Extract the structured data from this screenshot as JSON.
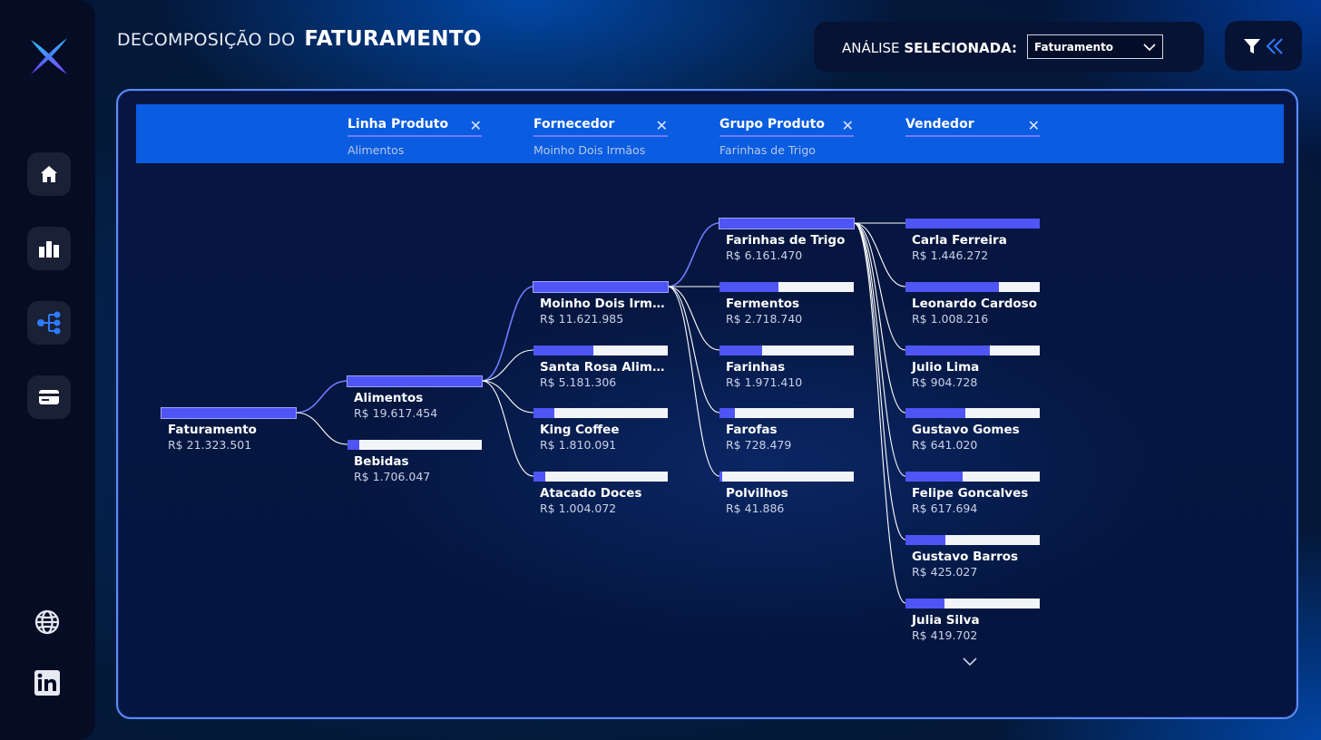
{
  "header": {
    "title_light": "DECOMPOSIÇÃO DO",
    "title_bold": "FATURAMENTO",
    "analysis_label": "ANÁLISE",
    "analysis_label_bold": "SELECIONADA:",
    "analysis_value": "Faturamento"
  },
  "sidebar": {
    "items": [
      {
        "name": "home",
        "icon": "home-icon"
      },
      {
        "name": "charts",
        "icon": "bar-chart-icon"
      },
      {
        "name": "decomposition",
        "icon": "tree-icon"
      },
      {
        "name": "card",
        "icon": "card-icon"
      }
    ],
    "bottom": [
      {
        "name": "website",
        "icon": "globe-icon"
      },
      {
        "name": "linkedin",
        "icon": "linkedin-icon"
      }
    ]
  },
  "colors": {
    "accent": "#4f54f5",
    "band": "#0a5ce0",
    "panel_border": "#5a8df0"
  },
  "tree": {
    "levels": [
      {
        "name": "Linha Produto",
        "selected": "Alimentos"
      },
      {
        "name": "Fornecedor",
        "selected": "Moinho Dois Irmãos"
      },
      {
        "name": "Grupo Produto",
        "selected": "Farinhas de Trigo"
      },
      {
        "name": "Vendedor",
        "selected": ""
      }
    ],
    "root": {
      "label": "Faturamento",
      "value": "R$ 21.323.501",
      "share": 1.0
    },
    "level1": [
      {
        "label": "Alimentos",
        "value": "R$ 19.617.454",
        "share": 1.0
      },
      {
        "label": "Bebidas",
        "value": "R$ 1.706.047",
        "share": 0.087
      }
    ],
    "level2": [
      {
        "label": "Moinho Dois Irmãos",
        "value": "R$ 11.621.985",
        "share": 1.0
      },
      {
        "label": "Santa Rosa Aliment...",
        "value": "R$ 5.181.306",
        "share": 0.446
      },
      {
        "label": "King Coffee",
        "value": "R$ 1.810.091",
        "share": 0.156
      },
      {
        "label": "Atacado Doces",
        "value": "R$ 1.004.072",
        "share": 0.086
      }
    ],
    "level3": [
      {
        "label": "Farinhas de Trigo",
        "value": "R$ 6.161.470",
        "share": 1.0
      },
      {
        "label": "Fermentos",
        "value": "R$ 2.718.740",
        "share": 0.441
      },
      {
        "label": "Farinhas",
        "value": "R$ 1.971.410",
        "share": 0.32
      },
      {
        "label": "Farofas",
        "value": "R$ 728.479",
        "share": 0.118
      },
      {
        "label": "Polvilhos",
        "value": "R$ 41.886",
        "share": 0.007
      }
    ],
    "level4": [
      {
        "label": "Carla Ferreira",
        "value": "R$ 1.446.272",
        "share": 1.0
      },
      {
        "label": "Leonardo Cardoso",
        "value": "R$ 1.008.216",
        "share": 0.697
      },
      {
        "label": "Julio Lima",
        "value": "R$ 904.728",
        "share": 0.626
      },
      {
        "label": "Gustavo Gomes",
        "value": "R$ 641.020",
        "share": 0.443
      },
      {
        "label": "Felipe Goncalves",
        "value": "R$ 617.694",
        "share": 0.427
      },
      {
        "label": "Gustavo Barros",
        "value": "R$ 425.027",
        "share": 0.294
      },
      {
        "label": "Julia Silva",
        "value": "R$ 419.702",
        "share": 0.29
      }
    ]
  }
}
